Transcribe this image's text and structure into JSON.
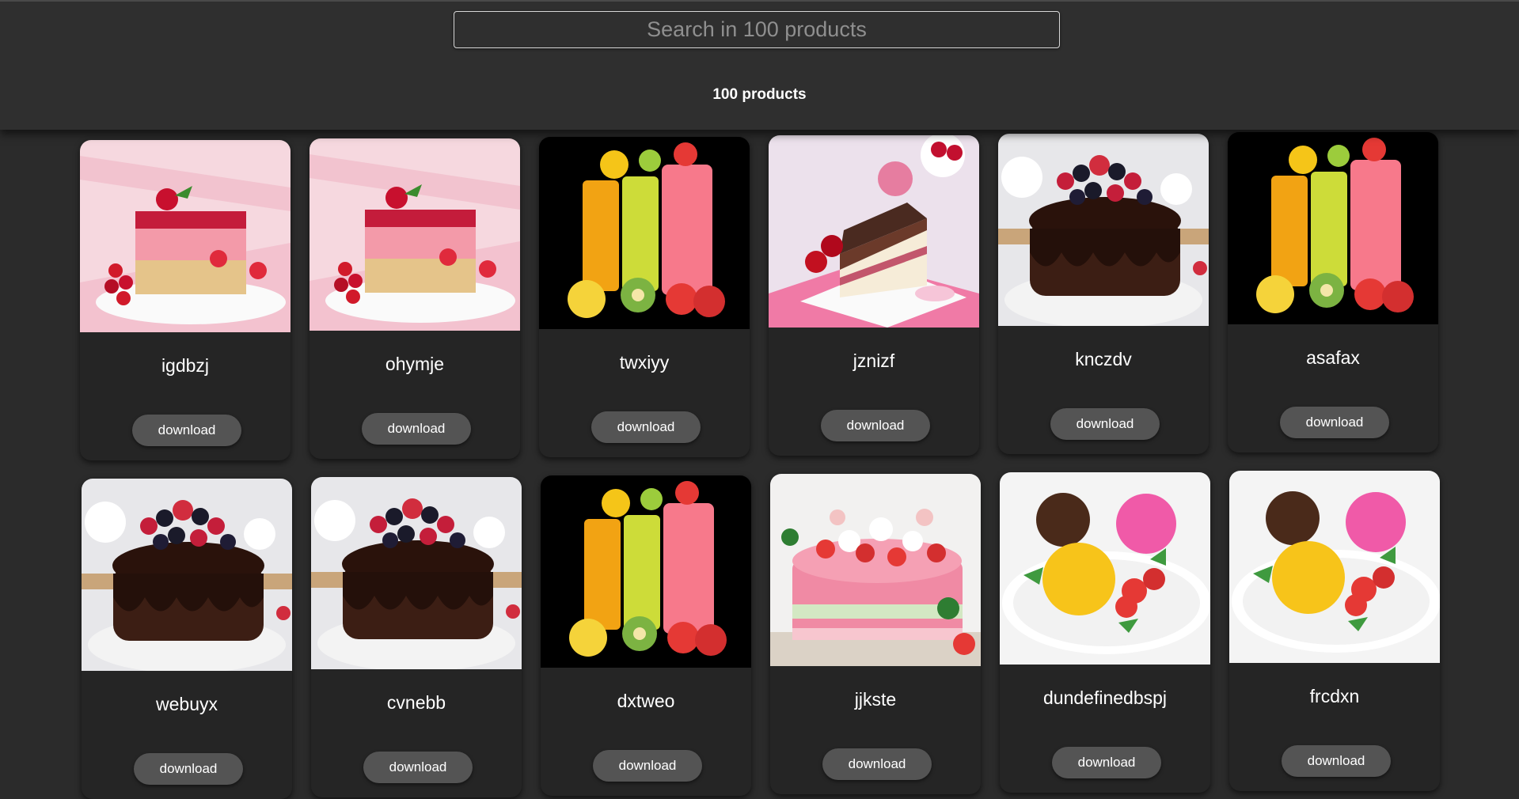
{
  "search": {
    "placeholder": "Search in 100 products"
  },
  "count_label": "100 products",
  "products": [
    {
      "name": "igdbzj",
      "image": "strawberry-mousse-cake",
      "button": "download"
    },
    {
      "name": "ohymje",
      "image": "strawberry-mousse-cake",
      "button": "download"
    },
    {
      "name": "twxiyy",
      "image": "fruit-smoothies",
      "button": "download"
    },
    {
      "name": "jznizf",
      "image": "layer-cake-slice",
      "button": "download"
    },
    {
      "name": "knczdv",
      "image": "chocolate-berry-cake",
      "button": "download"
    },
    {
      "name": "asafax",
      "image": "fruit-smoothies",
      "button": "download"
    },
    {
      "name": "webuyx",
      "image": "chocolate-berry-cake",
      "button": "download"
    },
    {
      "name": "cvnebb",
      "image": "chocolate-berry-cake",
      "button": "download"
    },
    {
      "name": "dxtweo",
      "image": "fruit-smoothies",
      "button": "download"
    },
    {
      "name": "jjkste",
      "image": "strawberry-layer-cake",
      "button": "download"
    },
    {
      "name": "dundefinedbspj",
      "image": "ice-cream-scoops",
      "button": "download"
    },
    {
      "name": "frcdxn",
      "image": "ice-cream-scoops",
      "button": "download"
    }
  ]
}
